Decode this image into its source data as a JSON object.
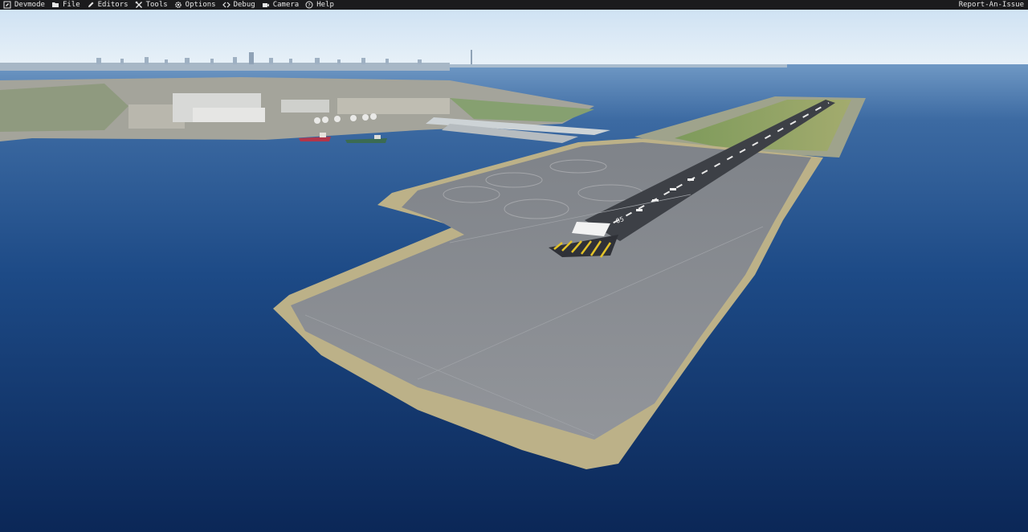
{
  "menubar": {
    "items": [
      {
        "label": "Devmode",
        "icon": "devmode-icon"
      },
      {
        "label": "File",
        "icon": "folder-icon"
      },
      {
        "label": "Editors",
        "icon": "pencil-icon"
      },
      {
        "label": "Tools",
        "icon": "tools-icon"
      },
      {
        "label": "Options",
        "icon": "gear-icon"
      },
      {
        "label": "Debug",
        "icon": "code-icon"
      },
      {
        "label": "Camera",
        "icon": "camera-icon"
      },
      {
        "label": "Help",
        "icon": "help-icon"
      }
    ],
    "report": "Report-An-Issue"
  },
  "scene": {
    "runway_number": "05",
    "colors": {
      "sky_top": "#cfe2f3",
      "sky_horizon": "#e6f0f8",
      "water_far": "#5a86b8",
      "water_near": "#0c2a58",
      "tarmac": "#8a8d93",
      "seawall": "#bdb48a",
      "grass": "#8ea36a",
      "menubar": "#1b1b1d"
    }
  }
}
